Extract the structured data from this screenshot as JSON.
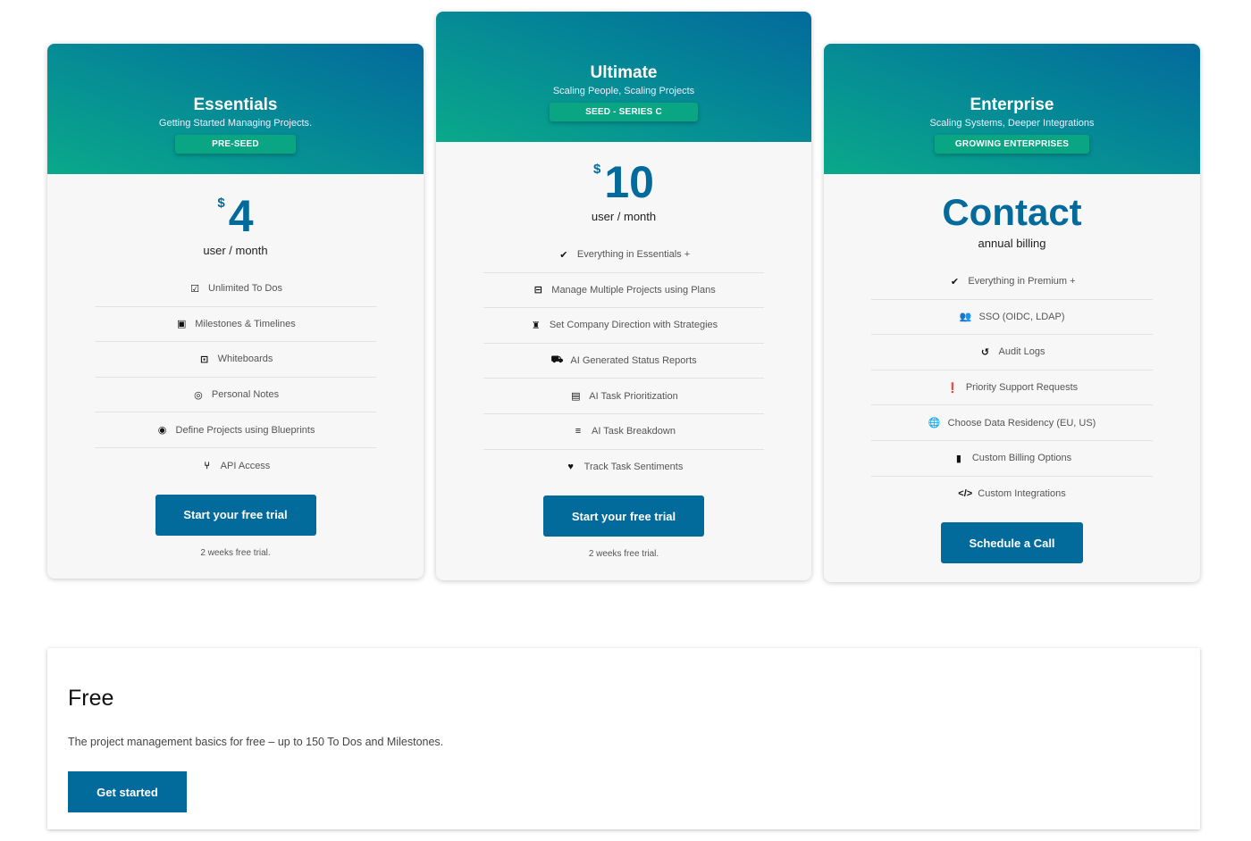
{
  "plans": [
    {
      "title": "Essentials",
      "subtitle": "Getting Started Managing Projects.",
      "badge": "PRE-SEED",
      "currency": "$",
      "amount": "4",
      "period": "user / month",
      "features": [
        {
          "icon": "checklist-icon",
          "glyph": "☑",
          "label": "Unlimited To Dos"
        },
        {
          "icon": "calendar-check-icon",
          "glyph": "▣",
          "label": "Milestones & Timelines"
        },
        {
          "icon": "presentation-icon",
          "glyph": "⊡",
          "label": "Whiteboards"
        },
        {
          "icon": "target-icon",
          "glyph": "◎",
          "label": "Personal Notes"
        },
        {
          "icon": "eye-icon",
          "glyph": "◉",
          "label": "Define Projects using Blueprints"
        },
        {
          "icon": "git-branch-icon",
          "glyph": "⑂",
          "label": "API Access"
        }
      ],
      "cta": "Start your free trial",
      "note": "2 weeks free trial."
    },
    {
      "title": "Ultimate",
      "subtitle": "Scaling People, Scaling Projects",
      "badge": "SEED - SERIES C",
      "currency": "$",
      "amount": "10",
      "period": "user / month",
      "features": [
        {
          "icon": "check-icon",
          "glyph": "✔",
          "label": "Everything in Essentials +"
        },
        {
          "icon": "briefcase-icon",
          "glyph": "⊟",
          "label": "Manage Multiple Projects using Plans"
        },
        {
          "icon": "chess-icon",
          "glyph": "♜",
          "label": "Set Company Direction with Strategies"
        },
        {
          "icon": "truck-robot-icon",
          "glyph": "⛟",
          "label": "AI Generated Status Reports"
        },
        {
          "icon": "file-icon",
          "glyph": "▤",
          "label": "AI Task Prioritization"
        },
        {
          "icon": "bars-icon",
          "glyph": "≡",
          "label": "AI Task Breakdown"
        },
        {
          "icon": "hand-heart-icon",
          "glyph": "♥",
          "label": "Track Task Sentiments"
        }
      ],
      "cta": "Start your free trial",
      "note": "2 weeks free trial."
    },
    {
      "title": "Enterprise",
      "subtitle": "Scaling Systems, Deeper Integrations",
      "badge": "GROWING ENTERPRISES",
      "contact": "Contact",
      "period": "annual billing",
      "features": [
        {
          "icon": "check-icon",
          "glyph": "✔",
          "label": "Everything in Premium +"
        },
        {
          "icon": "user-lock-icon",
          "glyph": "👥",
          "label": "SSO (OIDC, LDAP)"
        },
        {
          "icon": "history-icon",
          "glyph": "↺",
          "label": "Audit Logs"
        },
        {
          "icon": "exclamation-circle-icon",
          "glyph": "❗",
          "label": "Priority Support Requests"
        },
        {
          "icon": "globe-icon",
          "glyph": "🌐",
          "label": "Choose Data Residency (EU, US)"
        },
        {
          "icon": "invoice-dollar-icon",
          "glyph": "▮",
          "label": "Custom Billing Options"
        },
        {
          "icon": "code-icon",
          "glyph": "</>",
          "label": "Custom Integrations"
        }
      ],
      "cta": "Schedule a Call"
    }
  ],
  "free": {
    "title": "Free",
    "description": "The project management basics for free – up to 150 To Dos and Milestones.",
    "cta": "Get started"
  },
  "colors": {
    "brand_blue": "#036a9c",
    "badge_green": "#0aa582",
    "gradient_start": "#0aa98a",
    "gradient_end": "#036a9c"
  }
}
